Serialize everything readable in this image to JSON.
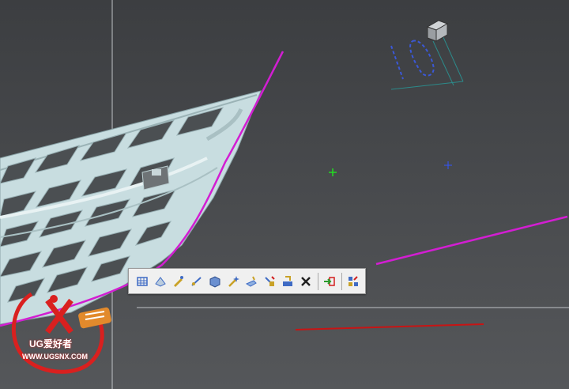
{
  "toolbar": {
    "tools": [
      {
        "name": "tool-layer-icon",
        "color": "#3f6bc4"
      },
      {
        "name": "tool-surface-icon",
        "color": "#3f6bc4"
      },
      {
        "name": "tool-edit-icon",
        "color": "#c9a227"
      },
      {
        "name": "tool-link-icon",
        "color": "#3f6bc4"
      },
      {
        "name": "tool-block-icon",
        "color": "#3f6bc4"
      },
      {
        "name": "tool-magic-icon",
        "color": "#c9a227"
      },
      {
        "name": "tool-hand-icon",
        "color": "#6a8fd0"
      },
      {
        "name": "tool-transform-icon",
        "color": "#3f6bc4"
      },
      {
        "name": "tool-move-icon",
        "color": "#c9a227"
      }
    ],
    "delete_icon": "close-icon",
    "extra_tools": [
      "tool-export-icon",
      "tool-layout-icon"
    ]
  },
  "watermark": {
    "brand": "UG爱好者",
    "url": "WWW.UGSNX.COM",
    "accent": "#d9201f"
  },
  "colors": {
    "curve_magenta": "#d21ed2",
    "curve_red": "#c81414",
    "grille_fill": "#c8dde0",
    "origin_marker": "#22dd22",
    "point_marker": "#3355ff"
  }
}
